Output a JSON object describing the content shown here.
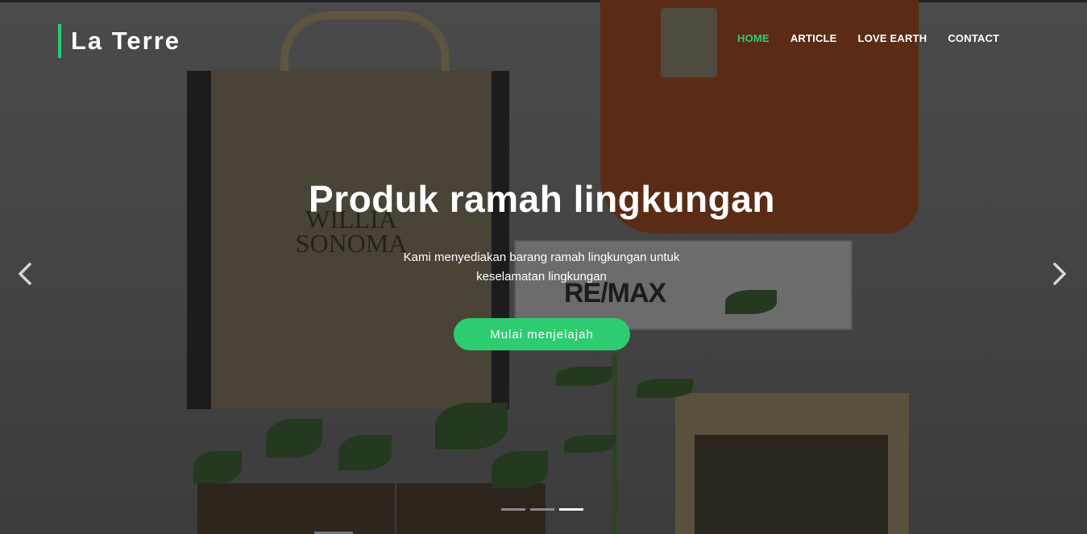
{
  "header": {
    "brand": "La Terre",
    "nav": [
      {
        "label": "HOME",
        "active": true
      },
      {
        "label": "ARTICLE",
        "active": false
      },
      {
        "label": "LOVE EARTH",
        "active": false
      },
      {
        "label": "CONTACT",
        "active": false
      }
    ]
  },
  "hero": {
    "headline": "Produk ramah lingkungan",
    "subtext": "Kami menyediakan barang ramah lingkungan untuk keselamatan lingkungan",
    "cta_label": "Mulai menjelajah",
    "background_print": [
      "WILLIA",
      "SONOMA"
    ],
    "card_print": "RE/MAX",
    "prev_icon": "chevron-left-icon",
    "next_icon": "chevron-right-icon"
  },
  "carousel": {
    "slide_count": 3,
    "active_slide": 3
  },
  "colors": {
    "accent": "#2ecc71",
    "text": "#ffffff"
  }
}
